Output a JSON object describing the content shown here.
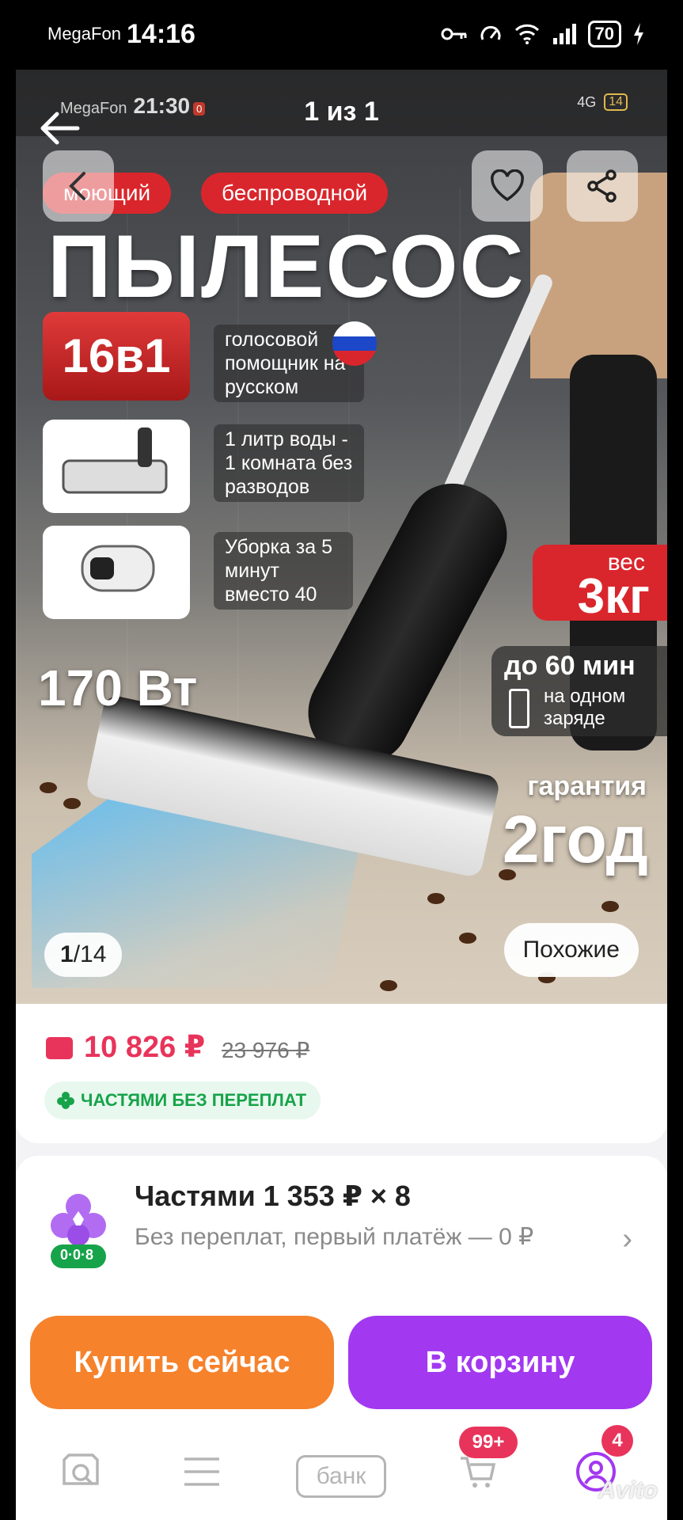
{
  "status_bar": {
    "carrier": "MegaFon",
    "time": "14:16",
    "battery": "70"
  },
  "inner_status": {
    "carrier": "MegaFon",
    "time": "21:30",
    "badge": "0",
    "net": "4G",
    "battery": "14"
  },
  "viewer": {
    "title": "1 из 1"
  },
  "ad": {
    "tags": [
      "моющий",
      "беспроводной"
    ],
    "headline": "ПЫЛЕСОС",
    "mode_badge": "16в1",
    "features": [
      "голосовой помощник на русском",
      "1 литр воды - 1 комната без разводов",
      "Уборка за 5 минут вместо 40"
    ],
    "power": "170 Вт",
    "weight_label": "вес",
    "weight_value": "3кг",
    "runtime_main": "до 60 мин",
    "runtime_sub": "на одном заряде",
    "warranty_label": "гарантия",
    "warranty_value": "2год"
  },
  "gallery": {
    "current": "1",
    "separator": "/",
    "total": "14",
    "similar_label": "Похожие"
  },
  "price": {
    "current": "10 826 ₽",
    "old": "23 976 ₽",
    "installment_pill": "ЧАСТЯМИ БЕЗ ПЕРЕПЛАТ"
  },
  "installments": {
    "title": "Частями 1 353 ₽  ×  8",
    "subtitle": "Без переплат, первый платёж — 0 ₽",
    "logo_text": "0·0·8"
  },
  "actions": {
    "buy": "Купить сейчас",
    "cart": "В корзину"
  },
  "bottom_nav": {
    "bank_label": "банк",
    "cart_badge": "99+",
    "profile_badge": "4",
    "watermark": "Avito"
  },
  "colors": {
    "accent_red": "#d9262c",
    "price_pink": "#e8345b",
    "buy_orange": "#f6822c",
    "cart_purple": "#a238f0",
    "green": "#17a34a"
  }
}
